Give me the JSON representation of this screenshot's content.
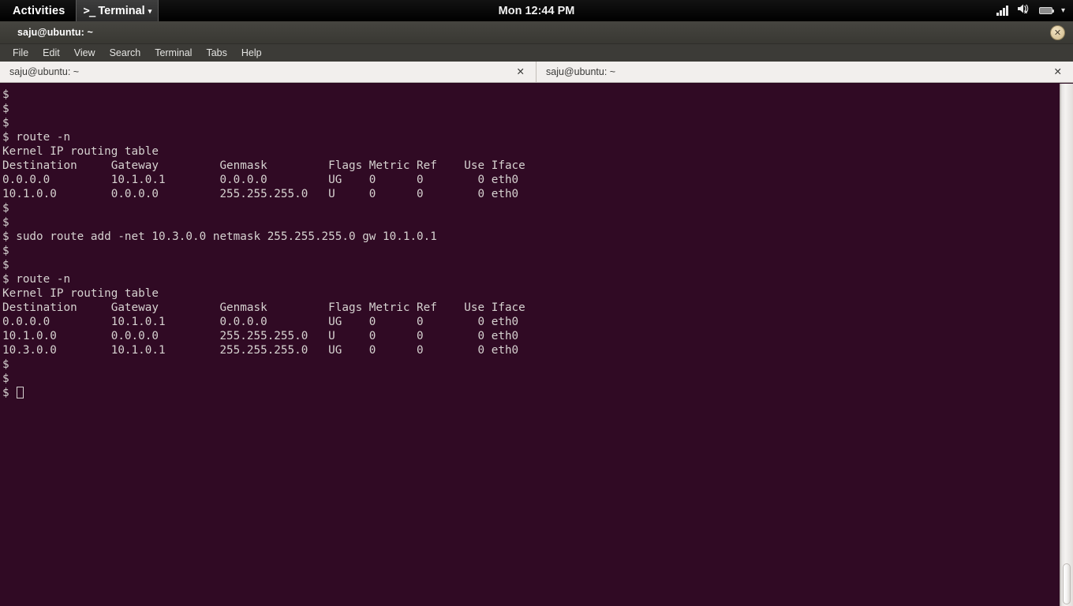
{
  "panel": {
    "activities": "Activities",
    "app_indicator": {
      "icon": "terminal-prompt-icon",
      "glyph": ">_",
      "label": "Terminal",
      "caret": "▾"
    },
    "clock": "Mon 12:44 PM",
    "tray": {
      "signal_icon": "signal-strength-icon",
      "volume_icon": "volume-muted-icon",
      "battery_icon": "battery-icon",
      "menu_caret": "▾"
    }
  },
  "window": {
    "title": "saju@ubuntu: ~",
    "close_label": "✕"
  },
  "menubar": {
    "items": [
      {
        "label": "File"
      },
      {
        "label": "Edit"
      },
      {
        "label": "View"
      },
      {
        "label": "Search"
      },
      {
        "label": "Terminal"
      },
      {
        "label": "Tabs"
      },
      {
        "label": "Help"
      }
    ]
  },
  "tabs": [
    {
      "label": "saju@ubuntu: ~",
      "close": "✕"
    },
    {
      "label": "saju@ubuntu: ~",
      "close": "✕"
    }
  ],
  "terminal": {
    "colors": {
      "background": "#300a24",
      "foreground": "#d6d2d0"
    },
    "lines": [
      "$",
      "$",
      "$",
      "$ route -n",
      "Kernel IP routing table",
      "Destination     Gateway         Genmask         Flags Metric Ref    Use Iface",
      "0.0.0.0         10.1.0.1        0.0.0.0         UG    0      0        0 eth0",
      "10.1.0.0        0.0.0.0         255.255.255.0   U     0      0        0 eth0",
      "$",
      "$",
      "$ sudo route add -net 10.3.0.0 netmask 255.255.255.0 gw 10.1.0.1",
      "$",
      "$",
      "$ route -n",
      "Kernel IP routing table",
      "Destination     Gateway         Genmask         Flags Metric Ref    Use Iface",
      "0.0.0.0         10.1.0.1        0.0.0.0         UG    0      0        0 eth0",
      "10.1.0.0        0.0.0.0         255.255.255.0   U     0      0        0 eth0",
      "10.3.0.0        10.1.0.1        255.255.255.0   UG    0      0        0 eth0",
      "$",
      "$"
    ],
    "prompt_last": "$",
    "cursor": "block-outline-cursor"
  }
}
